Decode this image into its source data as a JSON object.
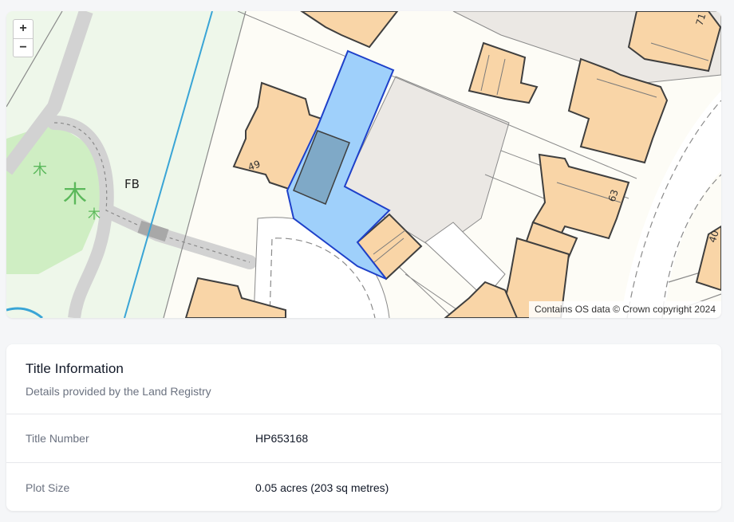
{
  "map": {
    "zoom_in_label": "+",
    "zoom_out_label": "−",
    "attribution": "Contains OS data © Crown copyright 2024",
    "labels": {
      "fb": "FB",
      "house_49": "49",
      "house_63": "63",
      "house_71": "71",
      "house_40": "40"
    },
    "colors": {
      "background": "#fdfcf6",
      "park": "#eef7ea",
      "building": "#f9d5a7",
      "plot_fill": "#9fd0fb",
      "plot_stroke": "#1e40c9",
      "road": "#ffffff",
      "path": "#d2d2d2",
      "stream": "#3aa5d6",
      "tree": "#5bb85b"
    }
  },
  "title_info": {
    "heading": "Title Information",
    "subheading": "Details provided by the Land Registry",
    "rows": [
      {
        "label": "Title Number",
        "value": "HP653168"
      },
      {
        "label": "Plot Size",
        "value": "0.05 acres (203 sq metres)"
      }
    ]
  }
}
